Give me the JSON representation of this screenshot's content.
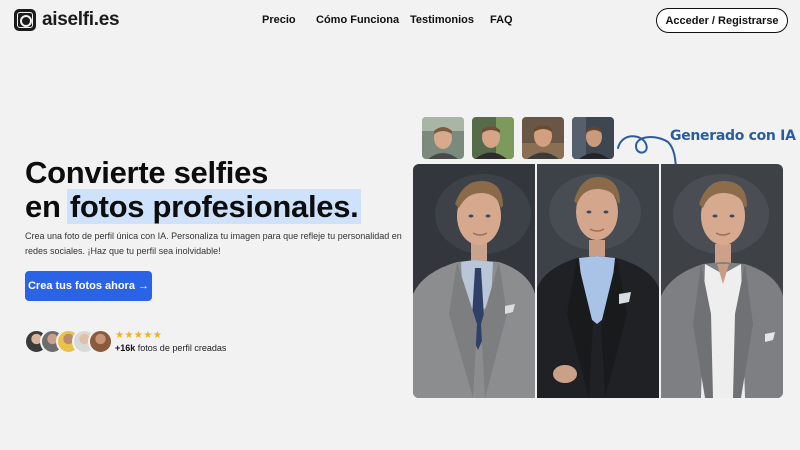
{
  "header": {
    "logo_text": "aiselfi.es",
    "nav": [
      "Precio",
      "Cómo Funciona",
      "Testimonios",
      "FAQ"
    ],
    "login_label": "Acceder / Registrarse"
  },
  "hero": {
    "title_line1": "Convierte selfies",
    "title_line2_prefix": "en",
    "title_line2_highlight": "fotos profesionales.",
    "subtitle": "Crea una foto de perfil única con IA. Personaliza tu imagen para que refleje tu personalidad en redes sociales. ¡Haz que tu perfil sea inolvidable!",
    "cta_label": "Crea tus fotos ahora →"
  },
  "social_proof": {
    "stars": "★★★★★",
    "count": "+16k",
    "count_text": "fotos de perfil creadas"
  },
  "gallery": {
    "annotation": "Generado con IA",
    "selfie_thumbnails": 4,
    "generated_photos": 3
  },
  "colors": {
    "accent": "#2a63e6",
    "highlight": "#cfe2fb",
    "annotation": "#2a5d9f",
    "stars": "#f2b01e"
  }
}
